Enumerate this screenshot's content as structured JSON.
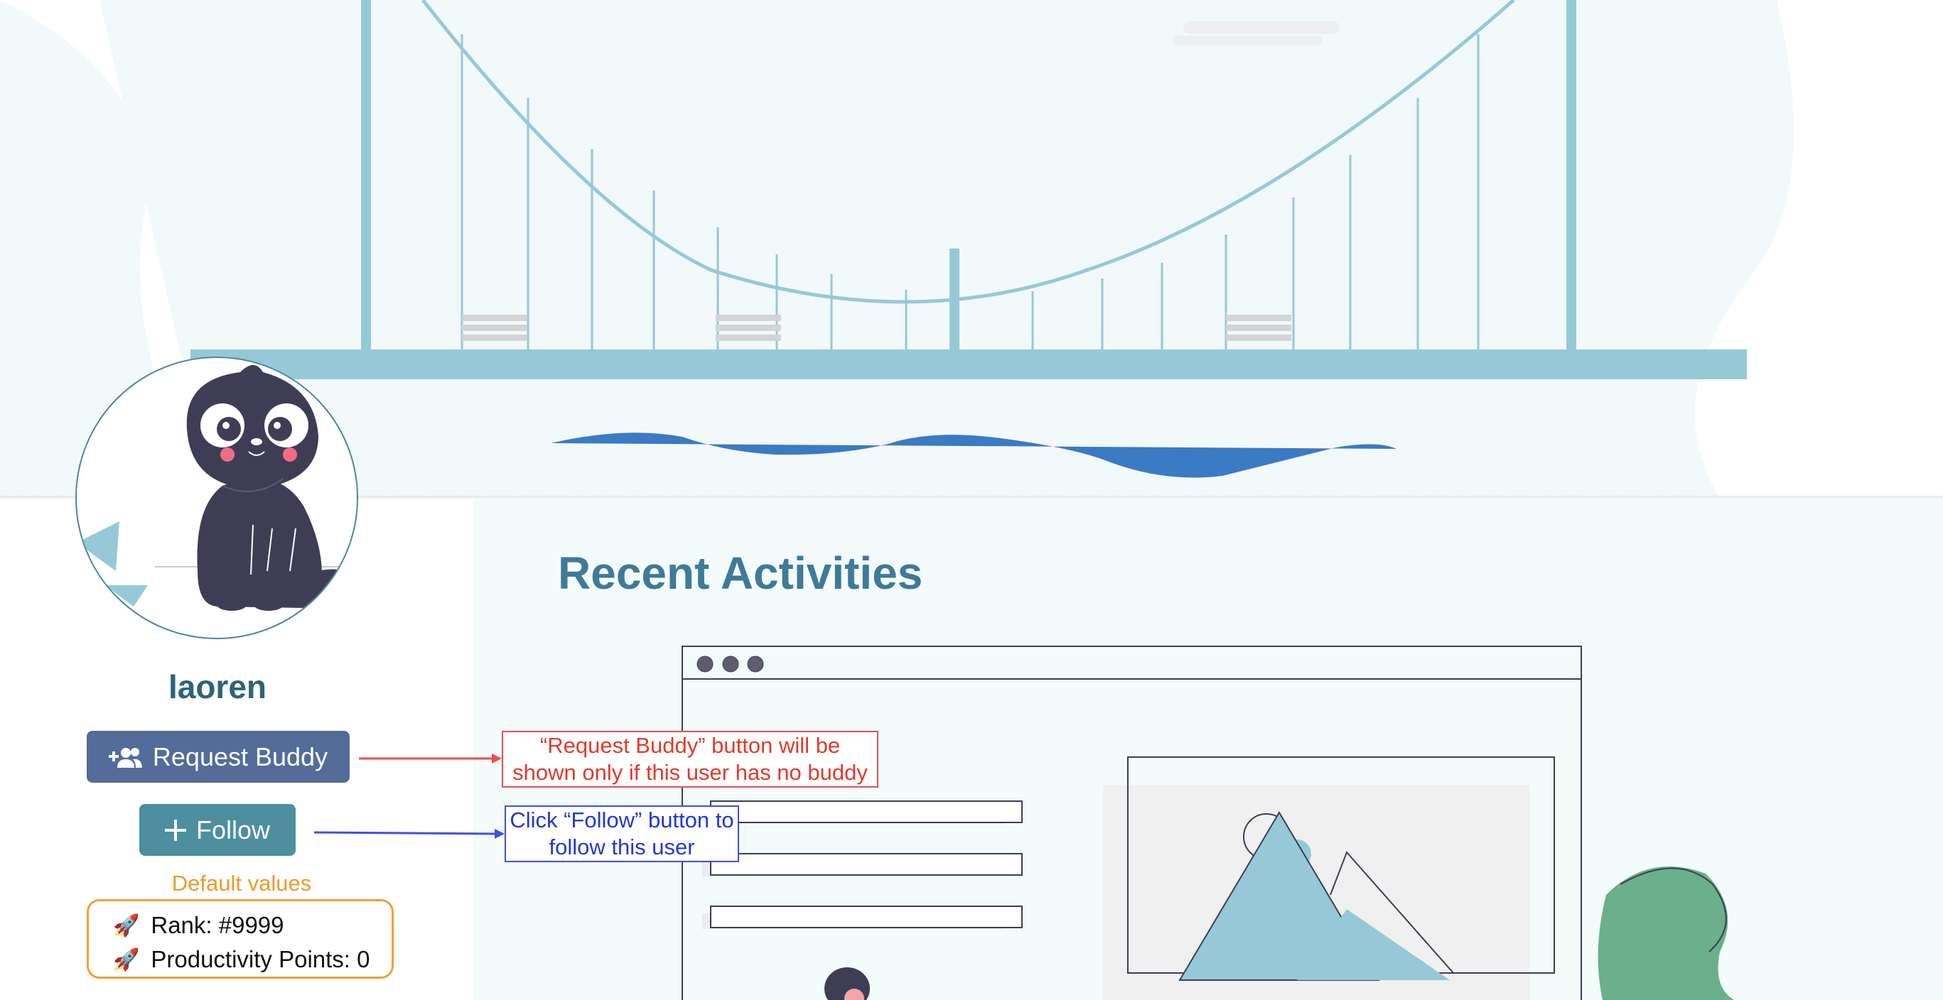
{
  "colors": {
    "hero_bg": "#f2f9fa",
    "bridge": "#96c9d7",
    "water": "#3b7ac4",
    "panel_bg": "#f3fbfb",
    "title": "#3f7a96",
    "buddy_button": "#536c99",
    "follow_button": "#4d8f9e",
    "annotation_red": "#e03b2b",
    "annotation_blue": "#2238d8",
    "defaults_orange": "#f0a03a"
  },
  "profile": {
    "username": "laoren",
    "avatar_icon": "cat-avatar-icon",
    "request_buddy_label": "Request Buddy",
    "request_buddy_icon": "add-user-icon",
    "follow_label": "Follow",
    "follow_icon": "plus-icon"
  },
  "annotations": {
    "request_buddy_note": "“Request Buddy” button will be shown only if this user has no buddy",
    "follow_note": "Click “Follow” button to follow this user",
    "defaults_label": "Default values"
  },
  "stats": {
    "icon": "rocket-icon",
    "rank": "Rank: #9999",
    "points": "Productivity Points: 0"
  },
  "main": {
    "title": "Recent Activities"
  }
}
